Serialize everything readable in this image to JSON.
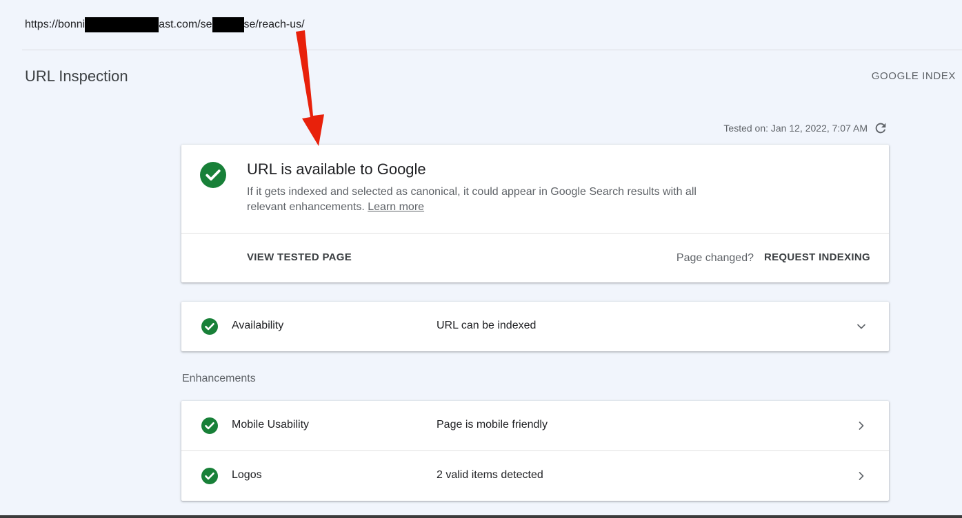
{
  "url_bar": {
    "part1": "https://bonni",
    "part2": "ast.com/se",
    "part3": "se/reach-us/"
  },
  "header": {
    "title": "URL Inspection",
    "google_index": "GOOGLE INDEX"
  },
  "tested": {
    "text": "Tested on: Jan 12, 2022, 7:07 AM",
    "refresh_icon": "refresh-icon"
  },
  "status_card": {
    "title": "URL is available to Google",
    "description": "If it gets indexed and selected as canonical, it could appear in Google Search results with all relevant enhancements.",
    "learn_more": "Learn more",
    "view_tested_page": "VIEW TESTED PAGE",
    "page_changed": "Page changed?",
    "request_indexing": "REQUEST INDEXING"
  },
  "availability": {
    "label": "Availability",
    "value": "URL can be indexed"
  },
  "enhancements": {
    "heading": "Enhancements",
    "items": [
      {
        "label": "Mobile Usability",
        "value": "Page is mobile friendly"
      },
      {
        "label": "Logos",
        "value": "2 valid items detected"
      }
    ]
  },
  "colors": {
    "success_green": "#188038",
    "annotation_arrow": "#e8210b",
    "background": "#f1f5fc"
  }
}
